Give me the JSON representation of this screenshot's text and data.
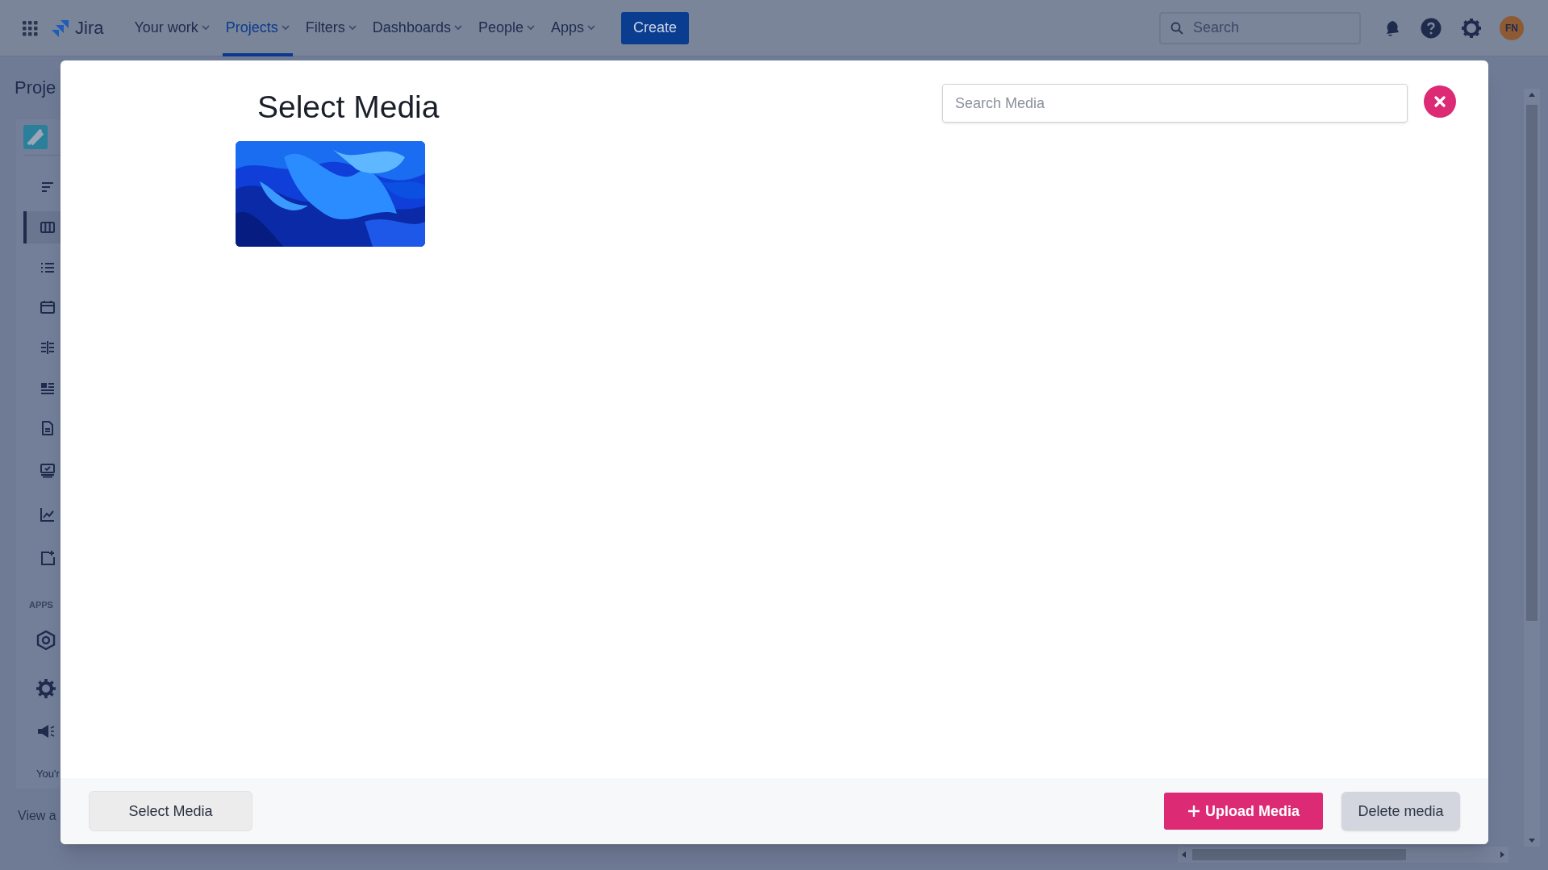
{
  "topbar": {
    "product": "Jira",
    "nav": [
      {
        "label": "Your work",
        "selected": false
      },
      {
        "label": "Projects",
        "selected": true
      },
      {
        "label": "Filters",
        "selected": false
      },
      {
        "label": "Dashboards",
        "selected": false
      },
      {
        "label": "People",
        "selected": false
      },
      {
        "label": "Apps",
        "selected": false
      }
    ],
    "create": "Create",
    "search": {
      "placeholder": "Search"
    },
    "avatar": "FN"
  },
  "sidebar": {
    "title": "Proje",
    "items": [
      {
        "selected": false
      },
      {
        "selected": true
      },
      {
        "selected": false
      },
      {
        "selected": false
      },
      {
        "selected": false
      },
      {
        "selected": false
      },
      {
        "selected": false
      },
      {
        "selected": false
      },
      {
        "selected": false
      },
      {
        "selected": false
      }
    ],
    "apps_heading": "APPS",
    "notice": "You'r",
    "footer_link": "View a"
  },
  "modal": {
    "title": "Select Media",
    "search": {
      "placeholder": "Search Media"
    },
    "buttons": {
      "select": "Select Media",
      "upload": "Upload Media",
      "delete": "Delete media"
    }
  }
}
